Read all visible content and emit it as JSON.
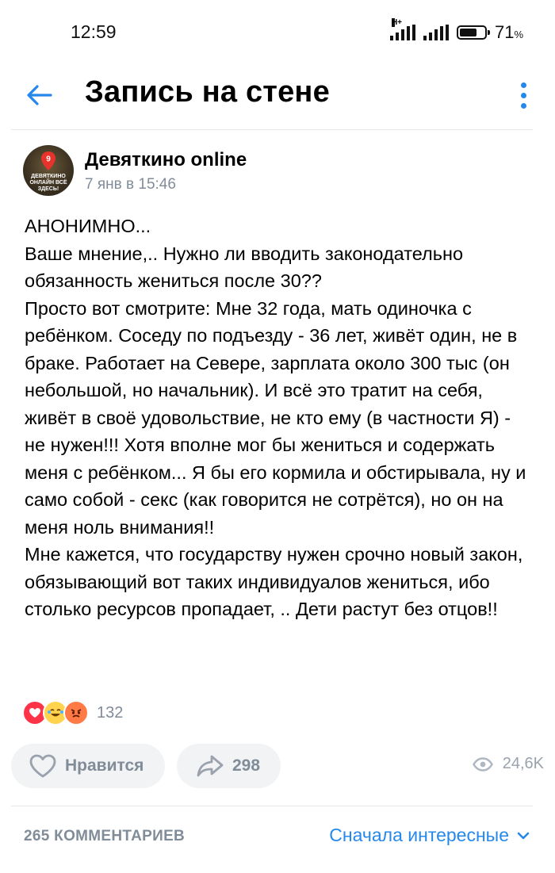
{
  "status_bar": {
    "time": "12:59",
    "network_type": "H+",
    "battery_percent": "71",
    "battery_unit": "%",
    "battery_level": 0.71
  },
  "header": {
    "title": "Запись на стене",
    "back_icon": "arrow-left-icon",
    "menu_icon": "more-vertical-icon",
    "accent_color": "#2688eb"
  },
  "post": {
    "author": "Девяткино online",
    "date": "7 янв в 15:46",
    "avatar_text": "ДЕВЯТКИНО ОНЛАЙН ВСЁ ЗДЕСЬ!",
    "avatar_number": "9",
    "paragraphs": [
      "АНОНИМНО...",
      "Ваше мнение,.. Нужно ли вводить законодательно обязанность жениться после 30??",
      "Просто вот смотрите: Мне 32 года, мать одиночка с ребёнком. Соседу по подъезду - 36 лет, живёт один, не в браке. Работает на Севере, зарплата около 300 тыс (он небольшой, но начальник). И всё это тратит на себя, живёт в своё удовольствие, не кто ему (в частности Я) - не нужен!!! Хотя вполне мог бы жениться и содержать меня с ребёнком... Я бы его кормила и обстирывала, ну и само собой - секс (как говорится не сотрётся), но он на меня ноль внимания!!",
      "Мне кажется, что государству нужен срочно новый закон, обязывающий вот таких индивидуалов жениться, ибо столько ресурсов пропадает, .. Дети растут без отцов!!"
    ]
  },
  "reactions": {
    "icons": [
      "heart-reaction-icon",
      "laughing-reaction-icon",
      "angry-reaction-icon"
    ],
    "count": "132"
  },
  "actions": {
    "like_label": "Нравится",
    "share_count": "298",
    "views_count": "24,6K"
  },
  "comments": {
    "count_label": "265 КОММЕНТАРИЕВ",
    "sort_label": "Сначала интересные"
  }
}
